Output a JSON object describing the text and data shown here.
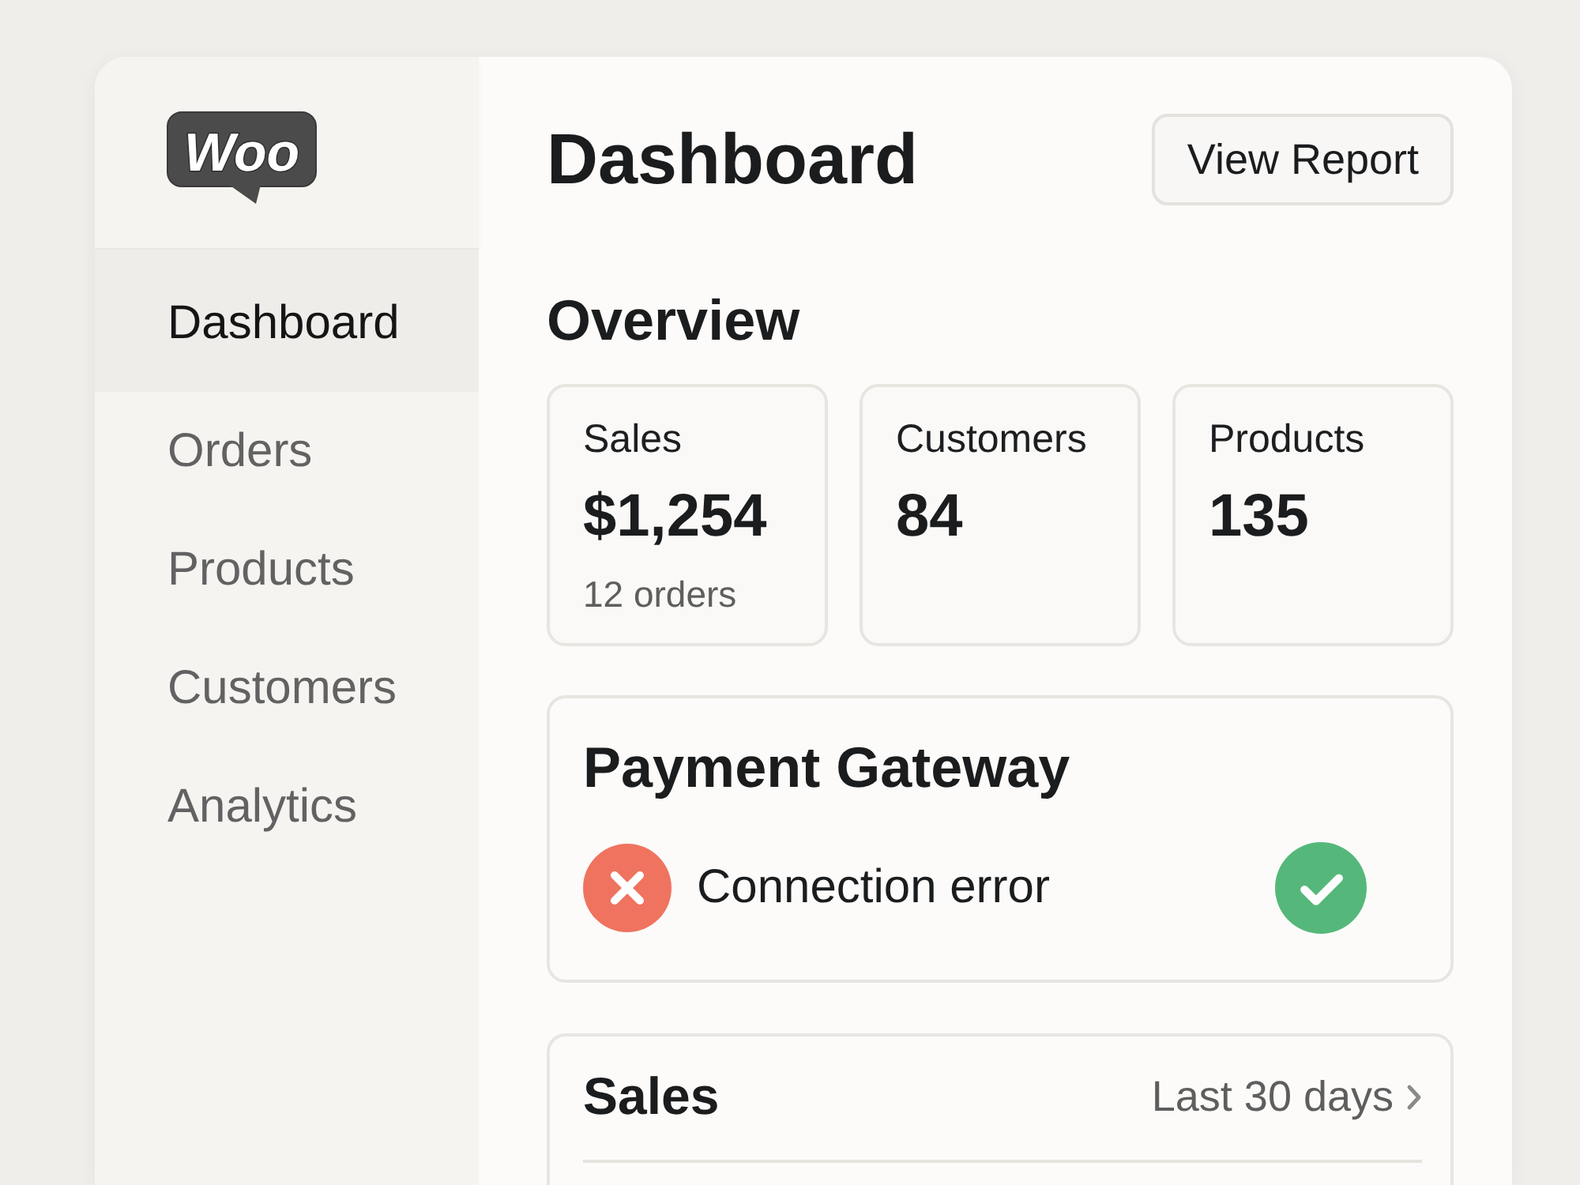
{
  "logo": {
    "text": "Woo"
  },
  "sidebar": {
    "items": [
      {
        "label": "Dashboard",
        "selected": true
      },
      {
        "label": "Orders",
        "selected": false
      },
      {
        "label": "Products",
        "selected": false
      },
      {
        "label": "Customers",
        "selected": false
      },
      {
        "label": "Analytics",
        "selected": false
      }
    ]
  },
  "header": {
    "title": "Dashboard",
    "button": "View Report"
  },
  "overview": {
    "title": "Overview",
    "stats": [
      {
        "label": "Sales",
        "value": "$1,254",
        "note": "12 orders"
      },
      {
        "label": "Customers",
        "value": "84"
      },
      {
        "label": "Products",
        "value": "135"
      }
    ]
  },
  "payment_gateway": {
    "title": "Payment Gateway",
    "status": {
      "kind": "error",
      "text": "Connection error"
    },
    "trailing_icon": {
      "kind": "success"
    }
  },
  "sales_panel": {
    "title": "Sales",
    "period": "Last 30 days"
  }
}
